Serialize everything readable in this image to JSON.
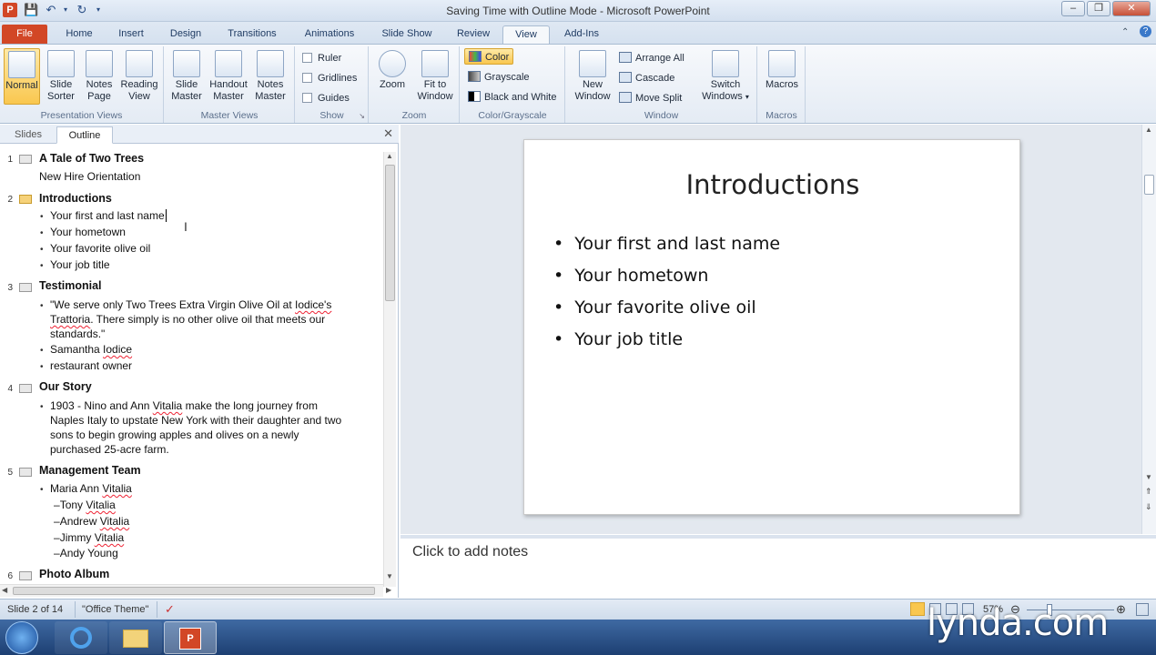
{
  "window": {
    "title": "Saving Time with Outline Mode - Microsoft PowerPoint"
  },
  "ribbon_tabs": [
    "File",
    "Home",
    "Insert",
    "Design",
    "Transitions",
    "Animations",
    "Slide Show",
    "Review",
    "View",
    "Add-Ins"
  ],
  "active_tab": "View",
  "ribbon": {
    "presentation_views": {
      "label": "Presentation Views",
      "normal": "Normal",
      "slide_sorter": "Slide Sorter",
      "notes_page": "Notes Page",
      "reading_view": "Reading View"
    },
    "master_views": {
      "label": "Master Views",
      "slide_master": "Slide Master",
      "handout_master": "Handout Master",
      "notes_master": "Notes Master"
    },
    "show": {
      "label": "Show",
      "ruler": "Ruler",
      "gridlines": "Gridlines",
      "guides": "Guides"
    },
    "zoom": {
      "label": "Zoom",
      "zoom": "Zoom",
      "fit_to_window": "Fit to Window"
    },
    "color_grayscale": {
      "label": "Color/Grayscale",
      "color": "Color",
      "grayscale": "Grayscale",
      "black_and_white": "Black and White"
    },
    "window": {
      "label": "Window",
      "new_window": "New Window",
      "arrange_all": "Arrange All",
      "cascade": "Cascade",
      "move_split": "Move Split",
      "switch_windows": "Switch Windows"
    },
    "macros": {
      "label": "Macros",
      "macros": "Macros"
    }
  },
  "pane_tabs": [
    "Slides",
    "Outline"
  ],
  "outline": {
    "s1": {
      "num": "1",
      "title": "A Tale of Two Trees",
      "sub": "New Hire Orientation"
    },
    "s2": {
      "num": "2",
      "title": "Introductions",
      "b1": "Your first and last name",
      "b2": "Your hometown",
      "b3": "Your favorite olive oil",
      "b4": "Your job title"
    },
    "s3": {
      "num": "3",
      "title": "Testimonial",
      "q1a": "\"We serve only Two Trees Extra Virgin Olive Oil at ",
      "q1b": "Iodice's",
      "q2a": "Trattoria",
      ". There simply is no other olive oil that meets our": "",
      "q2b": ". There simply is no other olive oil that meets our",
      "q3": "standards.\"",
      "n1a": "Samantha ",
      "n1b": "Iodice",
      "n2": "restaurant owner"
    },
    "s4": {
      "num": "4",
      "title": "Our Story",
      "l1a": "1903 - Nino and Ann ",
      "l1b": "Vitalia",
      " make the long journey from": "",
      "l1c": " make the long journey from",
      "l2": "Naples Italy to upstate New York with their daughter and two",
      "l3": "sons to begin growing apples and olives on a newly",
      "l4": "purchased 25-acre farm."
    },
    "s5": {
      "num": "5",
      "title": "Management Team",
      "m1a": "Maria Ann ",
      "m1b": "Vitalia",
      "m2a": "Tony ",
      "m2b": "Vitalia",
      "m3a": "Andrew ",
      "m3b": "Vitalia",
      "m4a": "Jimmy ",
      "m4b": "Vitalia",
      "m5": "Andy Young"
    },
    "s6": {
      "num": "6",
      "title": "Photo Album"
    }
  },
  "slide": {
    "title": "Introductions",
    "bullets": [
      "Your first and last name",
      "Your hometown",
      "Your favorite olive oil",
      "Your job title"
    ]
  },
  "notes_placeholder": "Click to add notes",
  "status": {
    "slide": "Slide 2 of 14",
    "theme": "\"Office Theme\"",
    "zoom": "57%"
  },
  "watermark": "lynda.com",
  "colors": {
    "file_tab": "#d24726",
    "selected_button": "#f9c74f",
    "slide_bg": "#ffffff",
    "edit_bg": "#e3e8ef"
  }
}
